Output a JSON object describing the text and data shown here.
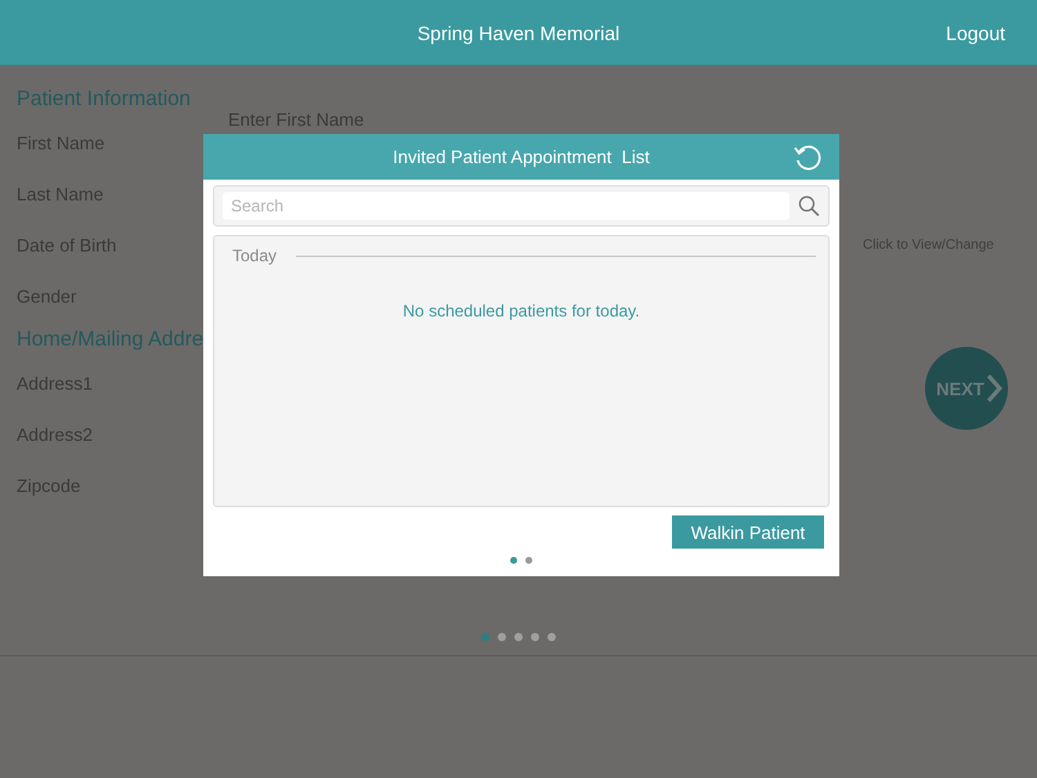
{
  "header": {
    "title": "Spring Haven Memorial",
    "logout": "Logout"
  },
  "form": {
    "sections": [
      {
        "title": "Patient Information",
        "fields": [
          {
            "label": "First Name",
            "placeholder": "Enter First Name"
          },
          {
            "label": "Last Name"
          },
          {
            "label": "Date of Birth",
            "hint": "Click to View/Change"
          },
          {
            "label": "Gender"
          }
        ]
      },
      {
        "title": "Home/Mailing Addre",
        "fields": [
          {
            "label": "Address1"
          },
          {
            "label": "Address2"
          },
          {
            "label": "Zipcode"
          }
        ]
      }
    ]
  },
  "next_button": "NEXT",
  "page_dots": [
    {
      "selected": true
    },
    {
      "selected": false
    },
    {
      "selected": false
    },
    {
      "selected": false
    },
    {
      "selected": false
    }
  ],
  "dialog": {
    "title": "Invited Patient Appointment  List",
    "search": {
      "placeholder": "Search"
    },
    "group": "Today",
    "empty_message": "No scheduled patients for today.",
    "walkin_button": "Walkin Patient",
    "page_dots": [
      {
        "selected": true
      },
      {
        "selected": false
      }
    ]
  }
}
